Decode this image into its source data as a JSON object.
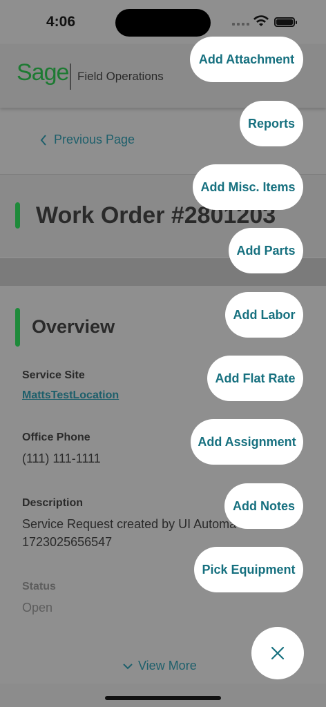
{
  "status_bar": {
    "time": "4:06"
  },
  "header": {
    "logo": "Sage",
    "product": "Field Operations"
  },
  "nav": {
    "previous_page": "Previous Page"
  },
  "work_order": {
    "title": "Work Order #2801203"
  },
  "overview": {
    "title": "Overview",
    "service_site_label": "Service Site",
    "service_site_value": "MattsTestLocation",
    "office_phone_label": "Office Phone",
    "office_phone_value": "(111) 111-1111",
    "description_label": "Description",
    "description_line1": "Service Request created by UI Automa",
    "description_line2": "1723025656547",
    "status_label": "Status",
    "status_value": "Open",
    "view_more": "View More"
  },
  "actions": {
    "add_attachment": "Add Attachment",
    "reports": "Reports",
    "add_misc_items": "Add Misc. Items",
    "add_parts": "Add Parts",
    "add_labor": "Add Labor",
    "add_flat_rate": "Add Flat Rate",
    "add_assignment": "Add Assignment",
    "add_notes": "Add Notes",
    "pick_equipment": "Pick Equipment"
  },
  "colors": {
    "accent_green": "#1e8a3a",
    "link_teal": "#16707f",
    "overlay_gray": "#8f8f8f"
  },
  "icons": {
    "close": "close-icon",
    "back": "chevron-left-icon",
    "expand": "chevron-down-icon"
  }
}
